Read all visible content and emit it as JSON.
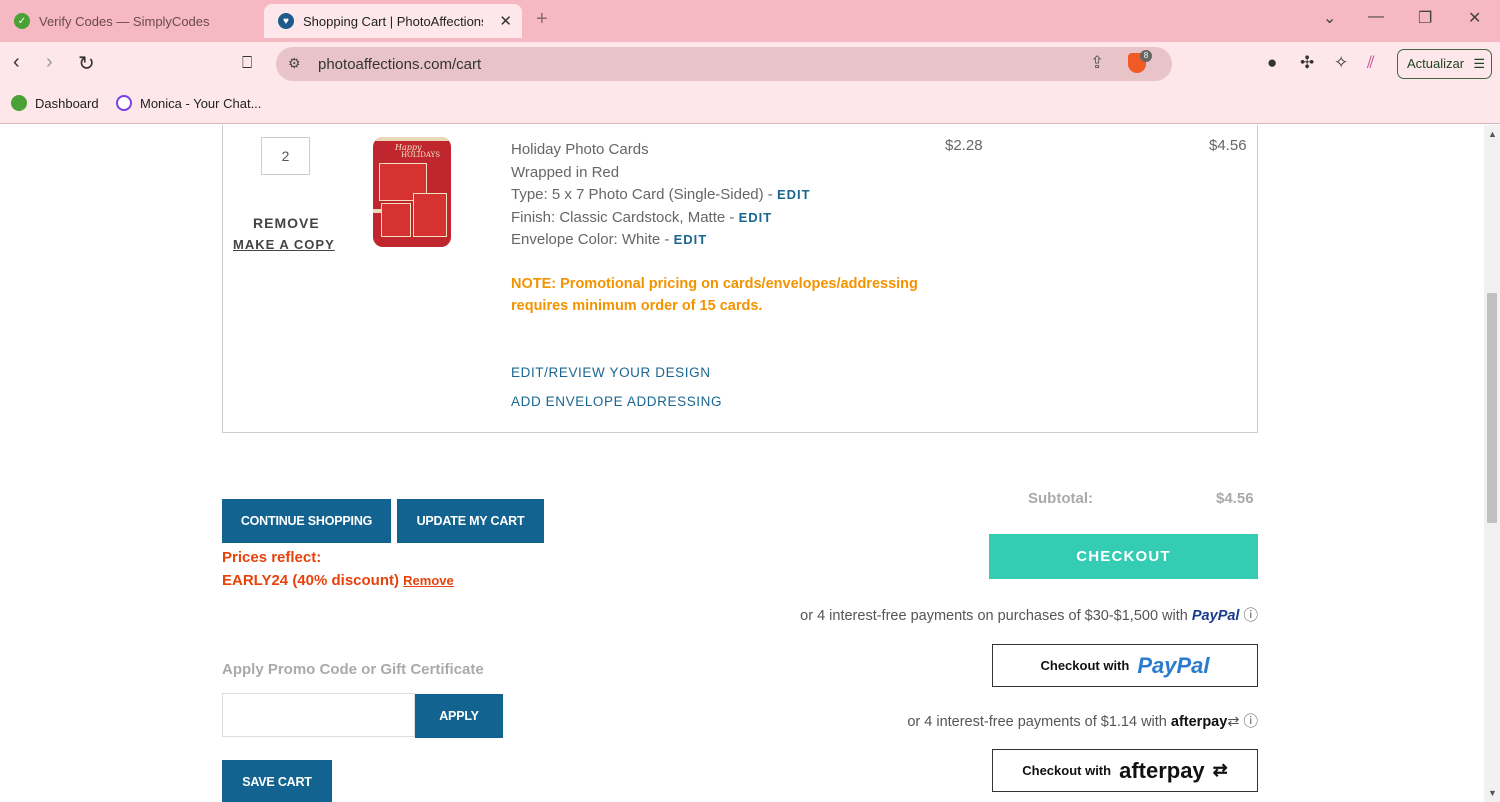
{
  "browser": {
    "tabs": [
      {
        "title": "Verify Codes — SimplyCodes",
        "active": false
      },
      {
        "title": "Shopping Cart | PhotoAffections",
        "active": true
      }
    ],
    "url": "photoaffections.com/cart",
    "update_button": "Actualizar",
    "brave_badge": "8",
    "bookmarks": [
      {
        "label": "Dashboard"
      },
      {
        "label": "Monica - Your Chat..."
      }
    ]
  },
  "cart_item": {
    "quantity": "2",
    "remove": "REMOVE",
    "make_copy": "MAKE A COPY",
    "product_name": "Holiday Photo Cards",
    "design_name": "Wrapped in Red",
    "type_text": "Type: 5 x 7 Photo Card (Single-Sided) - ",
    "finish_text": "Finish: Classic Cardstock, Matte - ",
    "envelope_text": "Envelope Color: White - ",
    "edit_label": "EDIT",
    "note": "NOTE: Promotional pricing on cards/envelopes/addressing requires minimum order of 15 cards.",
    "edit_review": "EDIT/REVIEW YOUR DESIGN",
    "add_addressing": "ADD ENVELOPE ADDRESSING",
    "unit_price": "$2.28",
    "line_total": "$4.56",
    "thumbnail_script": "Happy",
    "thumbnail_title": "HOLIDAYS"
  },
  "actions": {
    "continue_shopping": "CONTINUE SHOPPING",
    "update_cart": "UPDATE MY CART",
    "save_cart": "SAVE CART"
  },
  "promo": {
    "prices_reflect": "Prices reflect:",
    "code_applied": "EARLY24 (40% discount)",
    "remove_label": "Remove",
    "title": "Apply Promo Code or Gift Certificate",
    "input_value": "",
    "apply_label": "APPLY"
  },
  "summary": {
    "subtotal_label": "Subtotal:",
    "subtotal_value": "$4.56",
    "checkout_label": "CHECKOUT",
    "paypal_note": "or 4 interest-free payments on purchases of $30-$1,500 with",
    "paypal_brand": "PayPal",
    "paypal_with": "Checkout with",
    "afterpay_note": "or 4 interest-free payments of $1.14 with",
    "afterpay_brand": "afterpay",
    "afterpay_with": "Checkout with"
  },
  "colors": {
    "primary_button": "#12638f",
    "checkout": "#34cdb4",
    "promo_text": "#e8420c",
    "note_text": "#f29300",
    "link": "#1a6691",
    "tabbar": "#f6b8c2"
  }
}
